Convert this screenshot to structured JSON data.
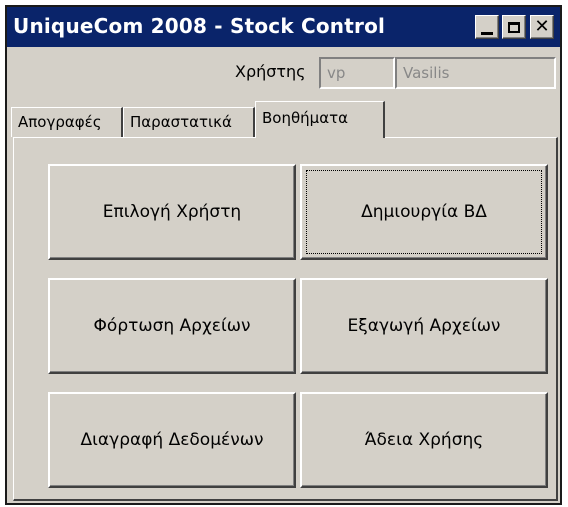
{
  "window": {
    "title": "UniqueCom 2008 - Stock Control",
    "controls": {
      "minimize_icon": "minimize-icon",
      "maximize_icon": "maximize-icon",
      "close_icon": "close-icon",
      "close_glyph": "✕"
    },
    "colors": {
      "titlebar": "#0a246a",
      "face": "#d4d0c8"
    }
  },
  "user": {
    "label": "Χρήστης",
    "code": "vp",
    "name": "Vasilis"
  },
  "tabs": [
    {
      "label": "Απογραφές",
      "active": false
    },
    {
      "label": "Παραστατικά",
      "active": false
    },
    {
      "label": "Βοηθήματα",
      "active": true
    }
  ],
  "actions": [
    {
      "label": "Επιλογή Χρήστη"
    },
    {
      "label": "Δημιουργία ΒΔ",
      "focused": true
    },
    {
      "label": "Φόρτωση Αρχείων"
    },
    {
      "label": "Εξαγωγή Αρχείων"
    },
    {
      "label": "Διαγραφή Δεδομένων"
    },
    {
      "label": "Άδεια Χρήσης"
    }
  ]
}
